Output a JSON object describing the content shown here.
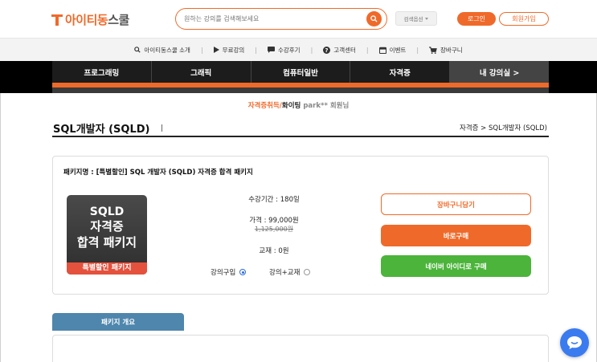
{
  "header": {
    "logo": {
      "part1": "아이티",
      "part2": "동",
      "part3": "스쿨"
    },
    "search": {
      "placeholder": "원하는 강의를 검색해보세요"
    },
    "search_option": "검색옵션",
    "login": "로그인",
    "join": "회원가입"
  },
  "subnav": {
    "items": [
      {
        "label": "아이티동스쿨 소개",
        "icon": "search-icon"
      },
      {
        "label": "무료강의",
        "icon": "play-icon"
      },
      {
        "label": "수강후기",
        "icon": "chat-icon"
      },
      {
        "label": "고객센터",
        "icon": "question-icon"
      },
      {
        "label": "이벤트",
        "icon": "calendar-icon"
      },
      {
        "label": "장바구니",
        "icon": "cart-icon"
      }
    ],
    "separator": "|"
  },
  "mainnav": {
    "tabs": [
      {
        "label": "프로그래밍"
      },
      {
        "label": "그래픽"
      },
      {
        "label": "컴퓨터일반"
      },
      {
        "label": "자격증"
      },
      {
        "label": "내 강의실  >"
      }
    ]
  },
  "greeting": {
    "part1": "자격증취득/",
    "part2": "화이팅 ",
    "part3": "park** 회원님"
  },
  "page": {
    "title": "SQL개발자 (SQLD)",
    "breadcrumb": "자격증 > SQL개발자 (SQLD)"
  },
  "package": {
    "name": "패키지명 : [특별할인] SQL 개발자 (SQLD) 자격증 합격 패키지",
    "thumbnail": {
      "line1": "SQLD",
      "line2": "자격증",
      "line3": "합격 패키지",
      "band": "특별할인 패키지"
    },
    "period": "수강기간 : 180일",
    "price": "가격 : 99,000원",
    "original_price": "1,125,000원",
    "book": "교재 : 0원",
    "options": [
      {
        "label": "강의구입",
        "selected": true
      },
      {
        "label": "강의+교재",
        "selected": false
      }
    ],
    "buttons": {
      "cart": "장바구니담기",
      "buy": "바로구매",
      "naver": "네이버 아이디로 구매"
    }
  },
  "overview": {
    "tab_label": "패키지 개요"
  },
  "colors": {
    "accent": "#ef6a2a",
    "naver": "#4cb43b",
    "overview_tab": "#4e86ad",
    "chat": "#3b7bf0"
  }
}
